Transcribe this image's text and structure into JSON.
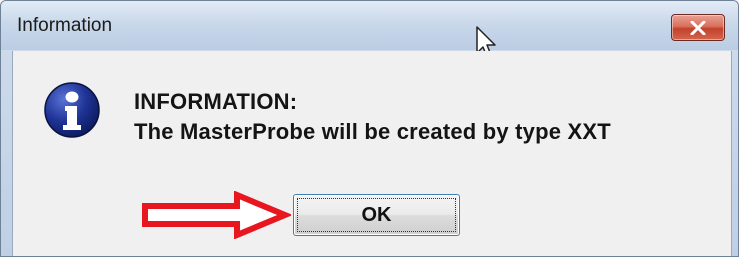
{
  "window": {
    "title": "Information",
    "close_icon": "close-x-icon"
  },
  "message": {
    "icon": "info-icon",
    "heading": "INFORMATION:",
    "body": "The MasterProbe will be created by type XXT"
  },
  "buttons": {
    "ok_label": "OK"
  },
  "annotation": {
    "arrow_color": "#e8161e",
    "arrow_icon": "red-arrow-icon"
  },
  "colors": {
    "close_button": "#c9503a",
    "info_icon": "#1a2d8a"
  }
}
